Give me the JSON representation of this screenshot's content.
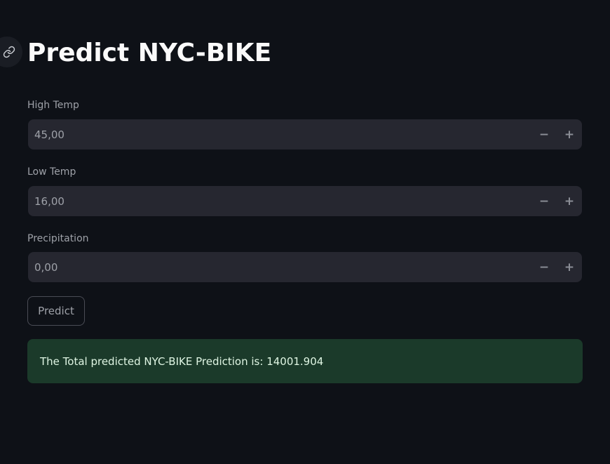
{
  "page": {
    "title": "Predict NYC-BIKE"
  },
  "icons": {
    "anchor": "link-icon",
    "decrement": "minus-icon",
    "increment": "plus-icon"
  },
  "fields": [
    {
      "label": "High Temp",
      "value": "45,00",
      "minus": "−",
      "plus": "+"
    },
    {
      "label": "Low Temp",
      "value": "16,00",
      "minus": "−",
      "plus": "+"
    },
    {
      "label": "Precipitation",
      "value": "0,00",
      "minus": "−",
      "plus": "+"
    }
  ],
  "actions": {
    "predict_label": "Predict"
  },
  "result": {
    "message": "The Total predicted NYC-BIKE Prediction is: 14001.904"
  },
  "colors": {
    "background": "#0e1117",
    "input_bg": "#262730",
    "success_bg": "#1b3a2a",
    "title": "#fafafa"
  }
}
